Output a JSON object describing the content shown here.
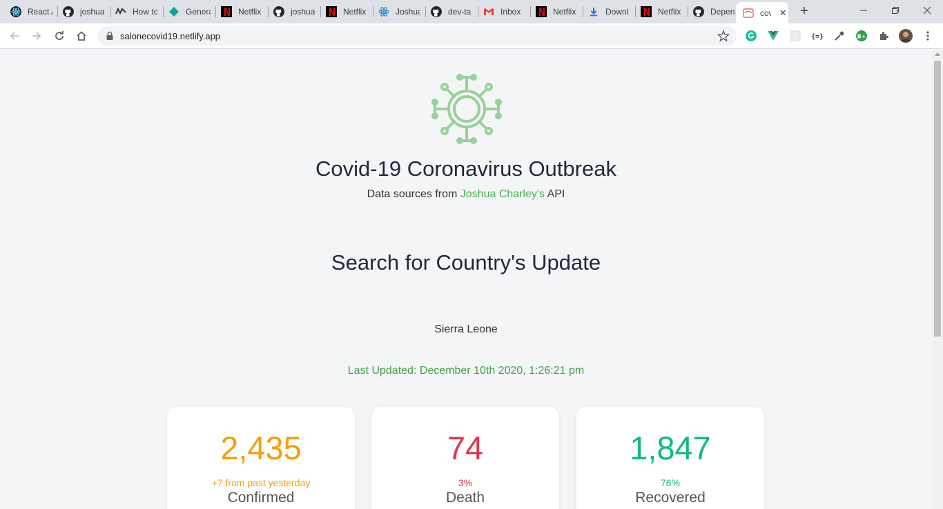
{
  "browser": {
    "tabs": [
      {
        "title": "React A",
        "icon": "react-icon"
      },
      {
        "title": "joshua",
        "icon": "github-icon"
      },
      {
        "title": "How to",
        "icon": "wave-icon"
      },
      {
        "title": "Genera",
        "icon": "diamond-icon"
      },
      {
        "title": "Netflix",
        "icon": "netflix-icon"
      },
      {
        "title": "joshua",
        "icon": "github-icon"
      },
      {
        "title": "Netflix",
        "icon": "netflix-icon"
      },
      {
        "title": "Joshua",
        "icon": "react-icon"
      },
      {
        "title": "dev-ta",
        "icon": "github-icon"
      },
      {
        "title": "Inbox",
        "icon": "gmail-icon"
      },
      {
        "title": "Netflix",
        "icon": "netflix-icon"
      },
      {
        "title": "Downl",
        "icon": "download-icon"
      },
      {
        "title": "Netflix",
        "icon": "netflix-icon"
      },
      {
        "title": "Depen",
        "icon": "github-icon"
      },
      {
        "title": "cov",
        "icon": "covid-site-icon",
        "active": true
      }
    ],
    "new_tab": "+",
    "url": "salonecovid19.netlify.app",
    "window_controls": {
      "minimize": "—",
      "maximize": "❐",
      "close": "✕"
    },
    "tab_close": "✕"
  },
  "page": {
    "title": "Covid-19 Coronavirus Outbreak",
    "source_prefix": "Data sources from ",
    "source_link": "Joshua Charley's",
    "source_suffix": " API",
    "search_heading": "Search for Country's Update",
    "country": "Sierra Leone",
    "last_updated": "Last Updated: December 10th 2020, 1:26:21 pm",
    "accent_color": "#4caf50"
  },
  "stats": [
    {
      "value": "2,435",
      "sub": "+7 from past yesterday",
      "label": "Confirmed",
      "color": "#f59e0b"
    },
    {
      "value": "74",
      "sub": "3%",
      "label": "Death",
      "color": "#e0364f"
    },
    {
      "value": "1,847",
      "sub": "76%",
      "label": "Recovered",
      "color": "#10b981"
    }
  ]
}
